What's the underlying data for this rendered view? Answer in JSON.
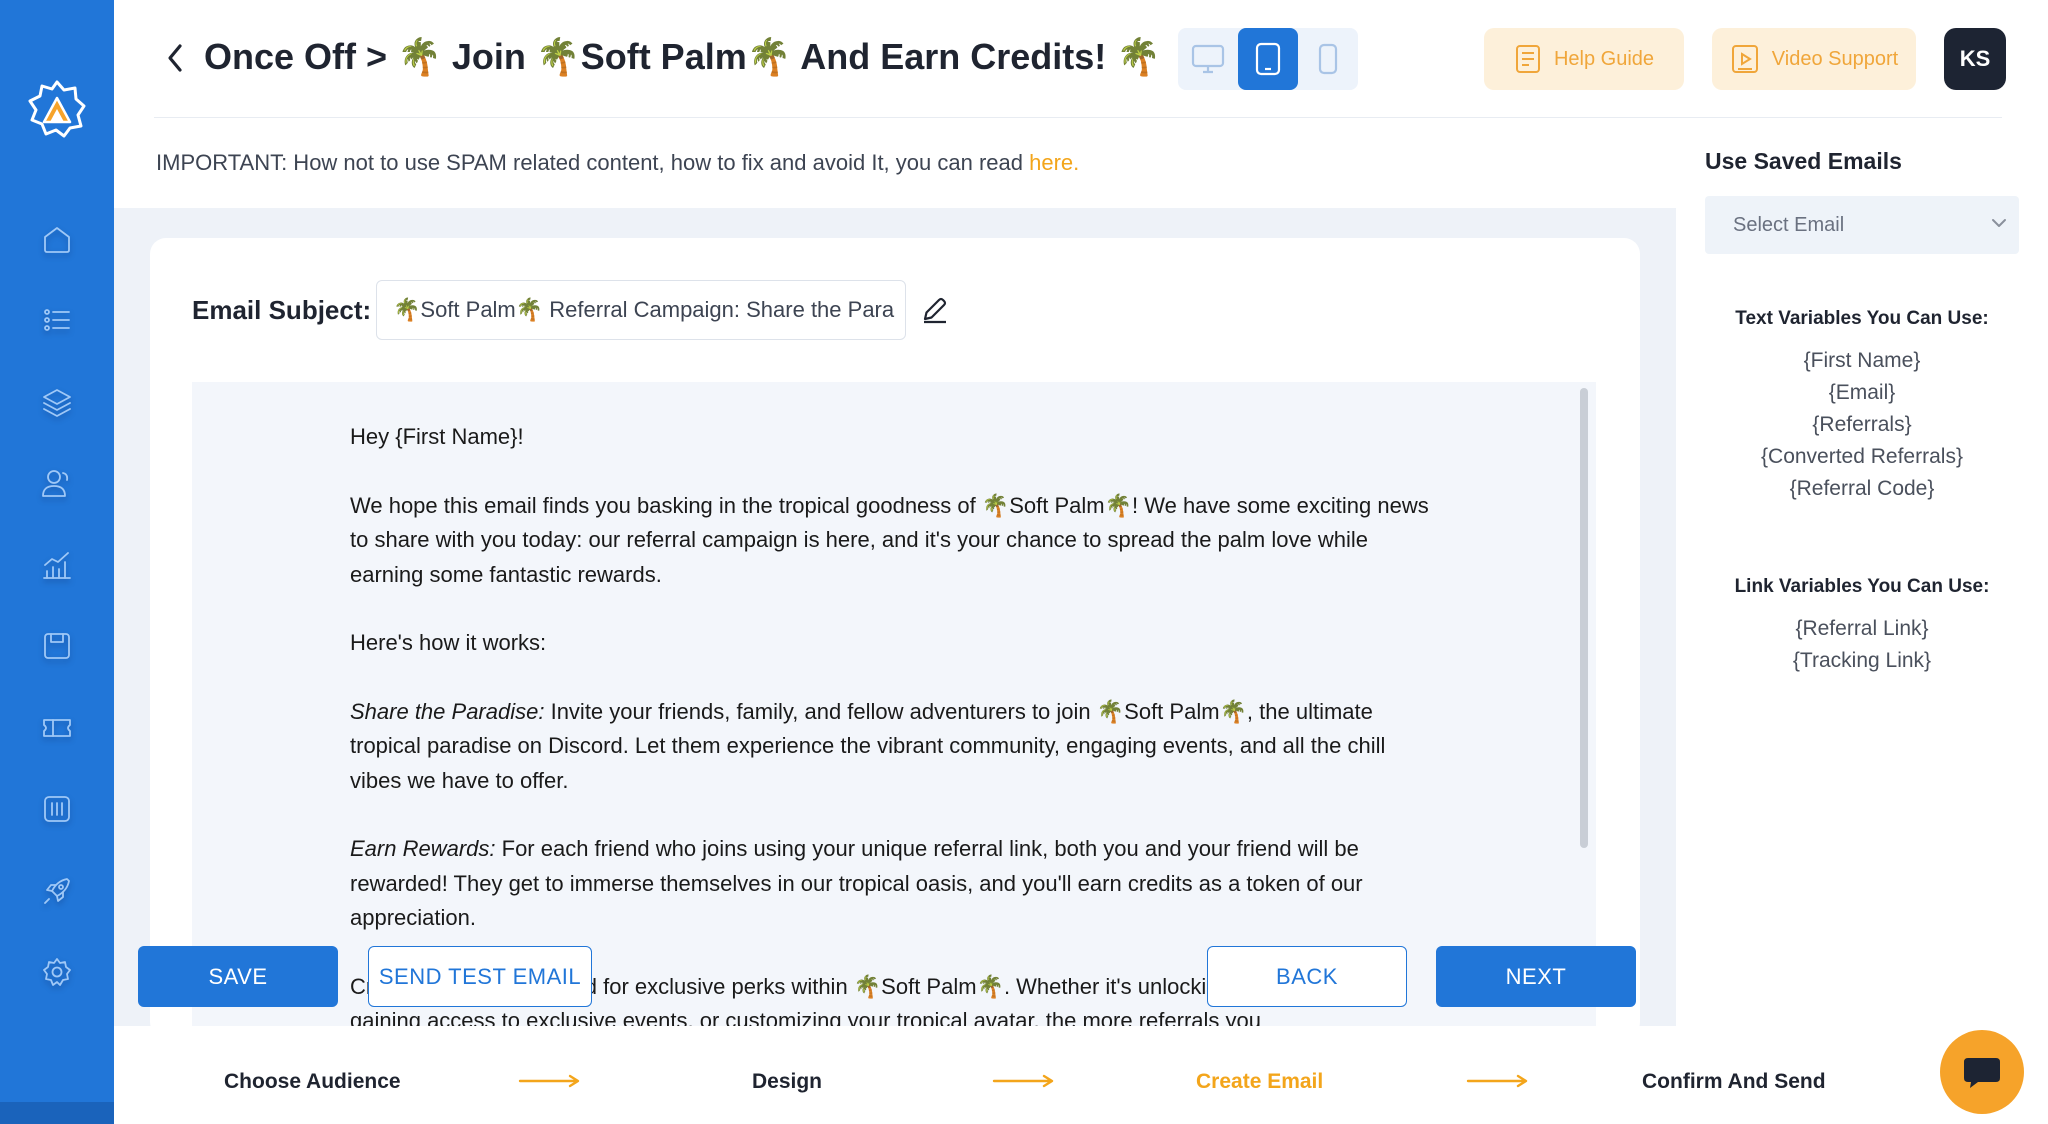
{
  "sidebar": {
    "items": [
      {
        "name": "home-icon"
      },
      {
        "name": "list-icon"
      },
      {
        "name": "layers-icon"
      },
      {
        "name": "users-icon"
      },
      {
        "name": "analytics-icon"
      },
      {
        "name": "save-icon"
      },
      {
        "name": "ticket-icon"
      },
      {
        "name": "reports-icon"
      },
      {
        "name": "rocket-icon"
      },
      {
        "name": "settings-icon"
      }
    ]
  },
  "header": {
    "title": "Once Off > 🌴 Join 🌴Soft Palm🌴 And Earn Credits! 🌴",
    "help_label": "Help Guide",
    "video_label": "Video Support",
    "avatar_initials": "KS",
    "accent_color": "#2176d8",
    "highlight_color": "#f3a51b"
  },
  "notice": {
    "text": "IMPORTANT:  How not to use SPAM related content, how to fix and avoid It, you can read ",
    "link": "here."
  },
  "editor": {
    "subject_label": "Email Subject:",
    "subject_value": "🌴Soft Palm🌴 Referral Campaign: Share the Para",
    "body": {
      "greeting": "Hey {First Name}!",
      "p1": "We hope this email finds you basking in the tropical goodness of 🌴Soft Palm🌴! We have some exciting news to share with you today: our referral campaign is here, and it's your chance to spread the palm love while earning some fantastic rewards.",
      "p2": "Here's how it works:",
      "p3_em": "Share the Paradise:",
      "p3": " Invite your friends, family, and fellow adventurers to join 🌴Soft Palm🌴, the ultimate tropical paradise on Discord. Let them experience the vibrant community, engaging events, and all the chill vibes we have to offer.",
      "p4_em": "Earn Rewards:",
      "p4": " For each friend who joins using your unique referral link, both you and your friend will be rewarded! They get to immerse themselves in our tropical oasis, and you'll earn credits as a token of our appreciation.",
      "p5": "Credits can be redeemed for exclusive perks within 🌴Soft Palm🌴. Whether it's unlocking special roles, gaining access to exclusive events, or customizing your tropical avatar, the more referrals you"
    }
  },
  "actions": {
    "save": "SAVE",
    "send_test": "SEND TEST EMAIL",
    "back": "BACK",
    "next": "NEXT"
  },
  "stepper": {
    "steps": [
      {
        "label": "Choose Audience",
        "active": false
      },
      {
        "label": "Design",
        "active": false
      },
      {
        "label": "Create Email",
        "active": true
      },
      {
        "label": "Confirm And Send",
        "active": false
      }
    ]
  },
  "right_panel": {
    "saved_title": "Use Saved Emails",
    "select_placeholder": "Select Email",
    "text_vars_heading": "Text Variables You Can Use:",
    "text_vars": [
      "{First Name}",
      "{Email}",
      "{Referrals}",
      "{Converted Referrals}",
      "{Referral Code}"
    ],
    "link_vars_heading": "Link Variables You Can Use:",
    "link_vars": [
      "{Referral Link}",
      "{Tracking Link}"
    ]
  }
}
